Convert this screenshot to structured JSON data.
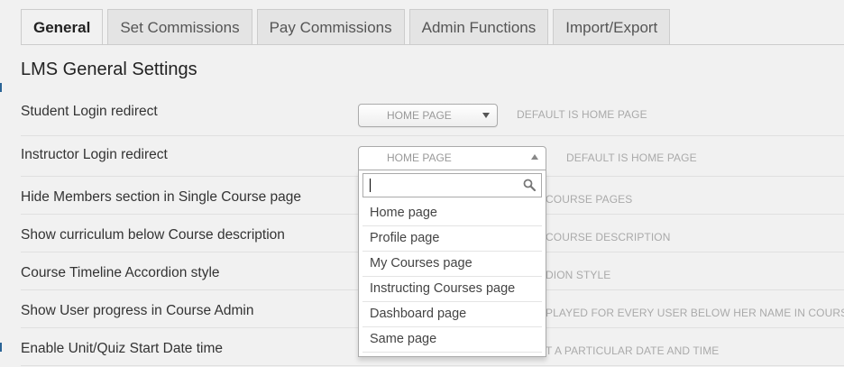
{
  "tabs": [
    {
      "label": "General",
      "active": true
    },
    {
      "label": "Set Commissions"
    },
    {
      "label": "Pay Commissions"
    },
    {
      "label": "Admin Functions"
    },
    {
      "label": "Import/Export"
    }
  ],
  "section_title": "LMS General Settings",
  "settings": [
    {
      "label": "Student Login redirect",
      "value": "HOME PAGE",
      "description": "DEFAULT IS HOME PAGE"
    },
    {
      "label": "Instructor Login redirect",
      "value": "HOME PAGE",
      "description": "DEFAULT IS HOME PAGE"
    },
    {
      "label": "Hide Members section in Single Course page",
      "description": "COURSE PAGES"
    },
    {
      "label": "Show curriculum below Course description",
      "description": "COURSE DESCRIPTION"
    },
    {
      "label": "Course Timeline Accordion style",
      "description": "DION STYLE"
    },
    {
      "label": "Show User progress in Course Admin",
      "description": "PLAYED FOR EVERY USER BELOW HER NAME IN COURSE ->"
    },
    {
      "label": "Enable Unit/Quiz Start Date time",
      "description": "T A PARTICULAR DATE AND TIME"
    }
  ],
  "dropdown": {
    "search_value": "",
    "options": [
      "Home page",
      "Profile page",
      "My Courses page",
      "Instructing Courses page",
      "Dashboard page",
      "Same page"
    ]
  },
  "icons": {
    "search": "search-icon",
    "arrow": "chevron-down-icon"
  },
  "colors": {
    "accent": "#2a6496",
    "page_bg": "#f1f1f1"
  }
}
